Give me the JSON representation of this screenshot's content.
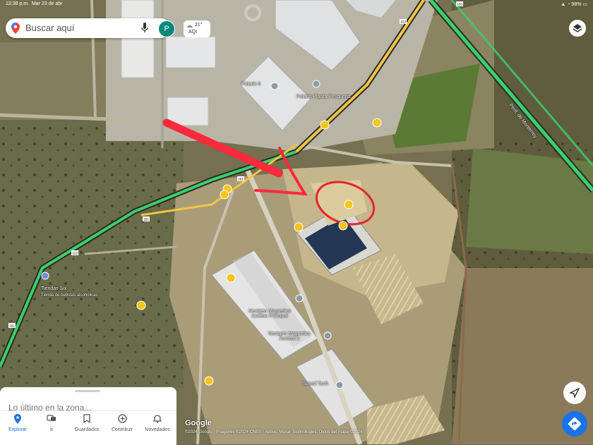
{
  "status_bar": {
    "time": "12:38 p.m.",
    "date": "Mar 23 de abr",
    "battery": "98%"
  },
  "search": {
    "placeholder": "Buscar aquí",
    "avatar_letter": "P"
  },
  "weather": {
    "temperature": "21°",
    "aqi": "AQI"
  },
  "map_labels": {
    "polaris6": "Polaris 6",
    "polaris_planta": "Polaris Planta Pesqueria",
    "highway": "Perif. de Monterrey",
    "tiendas": "Tiendas Six",
    "tiendas_sub": "Tienda de bebidas alcohólicas",
    "nextgen_principal": "Nextgen Magnetics\nAcceso Principal",
    "nextgen_2": "Nextgen Magnetics\nAcceso 2",
    "speedtech": "Speed Tech"
  },
  "road_shields": [
    "100",
    "102",
    "181",
    "181",
    "102",
    "181"
  ],
  "bottom_sheet": {
    "title": "Lo último en la zona..."
  },
  "nav": [
    {
      "label": "Explorar",
      "icon": "location-pin-icon",
      "active": true
    },
    {
      "label": "Ir",
      "icon": "commute-icon",
      "active": false
    },
    {
      "label": "Guardados",
      "icon": "bookmark-icon",
      "active": false
    },
    {
      "label": "Contribuir",
      "icon": "add-circle-icon",
      "active": false
    },
    {
      "label": "Novedades",
      "icon": "bell-icon",
      "active": false
    }
  ],
  "attribution": {
    "logo": "Google",
    "copyright": "©2024 Google · Imágenes ©2024 CNES / Airbus, Maxar Technologies, Datos del mapa ©2024"
  },
  "colors": {
    "annotation": "#ff2a3c",
    "nav_active": "#1a73e8",
    "traffic_green": "#3ccf6a",
    "traffic_yellow": "#f4c542"
  }
}
